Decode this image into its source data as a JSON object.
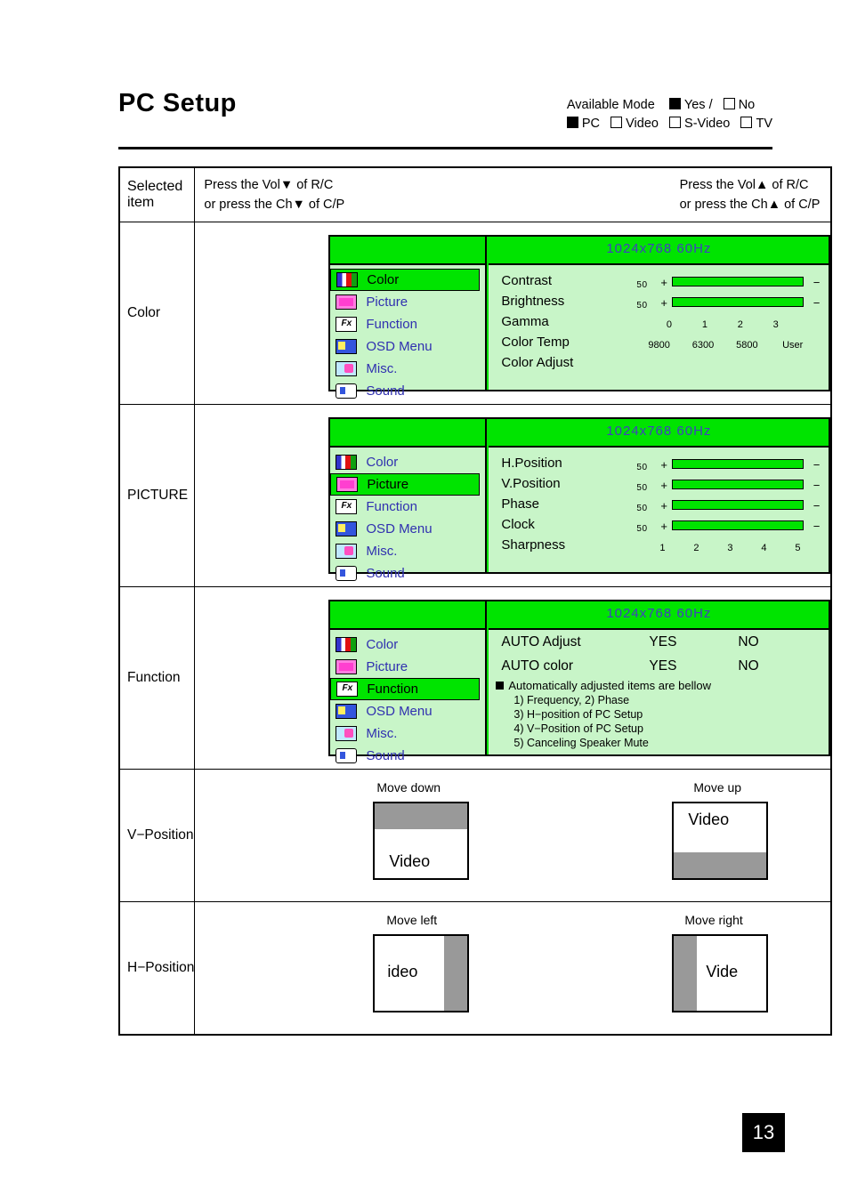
{
  "header": {
    "title": "PC Setup",
    "available_mode_label": "Available Mode",
    "yes_label": "Yes /",
    "no_label": "No",
    "modes": [
      "PC",
      "Video",
      "S-Video",
      "TV"
    ]
  },
  "table": {
    "col1_header": "Selected item",
    "col2_header_left_line1": "Press the Vol",
    "col2_header_left_line1_b": "▼",
    "col2_header_left_line1_tail": " of R/C",
    "col2_header_left_line2": "or press the Ch",
    "col2_header_left_line2_b": "▼",
    "col2_header_left_line2_tail": " of C/P",
    "col2_header_right_line1": "Press the Vol",
    "col2_header_right_line1_b": "▲",
    "col2_header_right_line1_tail": " of R/C",
    "col2_header_right_line2": "or press the Ch",
    "col2_header_right_line2_b": "▲",
    "col2_header_right_line2_tail": " of C/P"
  },
  "rows": {
    "color": {
      "label": "Color",
      "resolution": "1024x768   60Hz",
      "menu": [
        "Color",
        "Picture",
        "Function",
        "OSD Menu",
        "Misc.",
        "Sound"
      ],
      "selected": "Color",
      "options": [
        {
          "name": "Contrast",
          "value": "50",
          "plus": "+",
          "minus": "−",
          "type": "bar"
        },
        {
          "name": "Brightness",
          "value": "50",
          "plus": "+",
          "minus": "−",
          "type": "bar"
        },
        {
          "name": "Gamma",
          "type": "ticks",
          "ticks": [
            "0",
            "1",
            "2",
            "3"
          ]
        },
        {
          "name": "Color Temp",
          "type": "ticks",
          "ticks": [
            "9800",
            "6300",
            "5800",
            "User"
          ]
        },
        {
          "name": "Color Adjust",
          "type": "none"
        }
      ]
    },
    "picture": {
      "label": "PICTURE",
      "resolution": "1024x768   60Hz",
      "menu": [
        "Color",
        "Picture",
        "Function",
        "OSD Menu",
        "Misc.",
        "Sound"
      ],
      "selected": "Picture",
      "options": [
        {
          "name": "H.Position",
          "value": "50",
          "plus": "+",
          "minus": "−",
          "type": "bar"
        },
        {
          "name": "V.Position",
          "value": "50",
          "plus": "+",
          "minus": "−",
          "type": "bar"
        },
        {
          "name": "Phase",
          "value": "50",
          "plus": "+",
          "minus": "−",
          "type": "bar"
        },
        {
          "name": "Clock",
          "value": "50",
          "plus": "+",
          "minus": "−",
          "type": "bar"
        },
        {
          "name": "Sharpness",
          "type": "ticks",
          "ticks": [
            "1",
            "2",
            "3",
            "4",
            "5"
          ]
        }
      ]
    },
    "function": {
      "label": "Function",
      "resolution": "1024x768   60Hz",
      "menu": [
        "Color",
        "Picture",
        "Function",
        "OSD Menu",
        "Misc.",
        "Sound"
      ],
      "selected": "Function",
      "auto_adjust": {
        "name": "AUTO Adjust",
        "yes": "YES",
        "no": "NO"
      },
      "auto_color": {
        "name": "AUTO color",
        "yes": "YES",
        "no": "NO"
      },
      "note": "Automatically adjusted items are bellow",
      "sub_items": [
        "1) Frequency,    2) Phase",
        "3) H−position of PC Setup",
        "4) V−Position of PC Setup",
        "5) Canceling Speaker Mute"
      ]
    },
    "vposition": {
      "label": "V−Position",
      "left_caption": "Move down",
      "right_caption": "Move up",
      "left_text": "Video",
      "right_text": "Video"
    },
    "hposition": {
      "label": "H−Position",
      "left_caption": "Move left",
      "right_caption": "Move right",
      "left_text": "ideo",
      "right_text": "Vide"
    }
  },
  "page_number": "13",
  "colors": {
    "osd_green": "#00e400",
    "osd_light": "#c8f5c8",
    "osd_blue_text": "#3030b0",
    "gray": "#999999"
  }
}
